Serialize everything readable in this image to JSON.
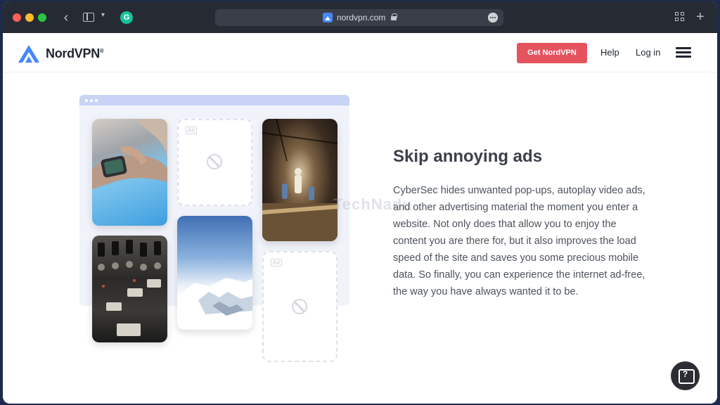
{
  "browser": {
    "url": "nordvpn.com",
    "back_icon": "‹",
    "more_icon": "•••",
    "new_tab_icon": "+",
    "extension_icon": "G"
  },
  "header": {
    "logo_text": "NordVPN",
    "logo_mark": "®",
    "cta_label": "Get NordVPN",
    "nav_help": "Help",
    "nav_login": "Log in"
  },
  "illustration": {
    "ad_label_1": "Ad",
    "ad_label_2": "Ad"
  },
  "content": {
    "heading": "Skip annoying ads",
    "body": "CyberSec hides unwanted pop-ups, autoplay video ads, and other advertising material the moment you enter a website. Not only does that allow you to enjoy the content you are there for, but it also improves the load speed of the site and saves you some precious mobile data. So finally, you can experience the internet ad-free, the way you have always wanted it to be."
  },
  "watermark": "TechNadu",
  "help_widget": {
    "icon_text": "?"
  },
  "colors": {
    "cta": "#e5535f",
    "brand": "#4687ff",
    "titlebar": "#262a33"
  }
}
